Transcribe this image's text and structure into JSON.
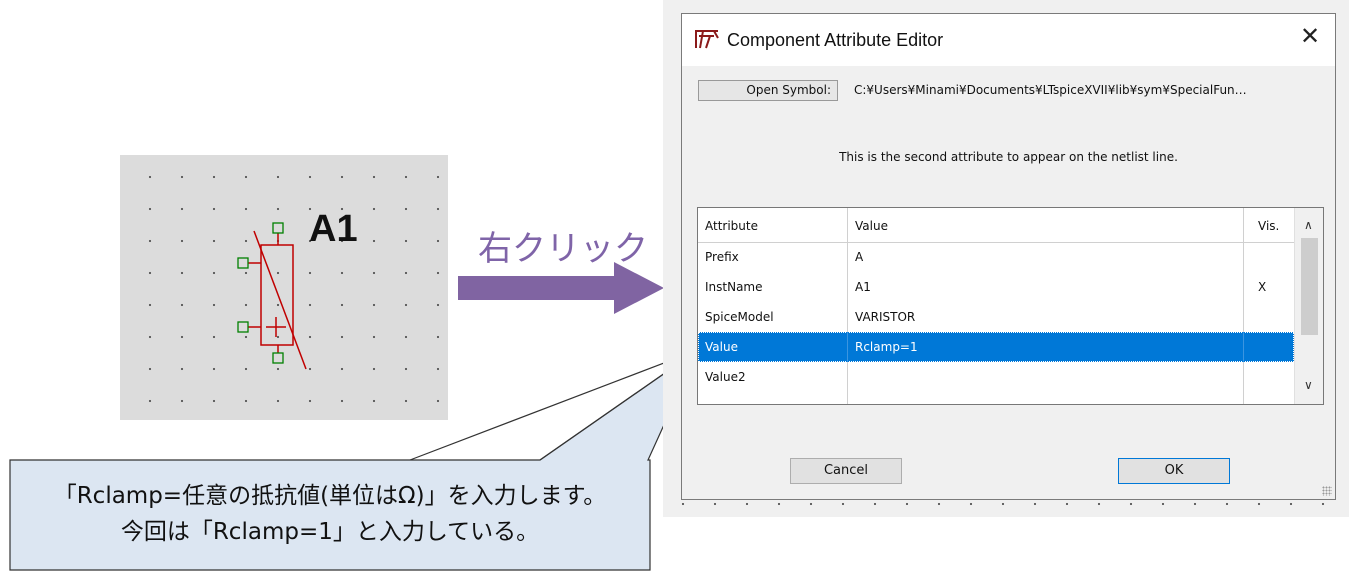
{
  "schematic": {
    "component_label": "A1"
  },
  "arrow": {
    "label": "右クリック",
    "color": "#8064a2"
  },
  "callout": {
    "line1": "「Rclamp=任意の抵抗値(単位はΩ)」を入力します。",
    "line2": "今回は「Rclamp=1」と入力している。"
  },
  "dialog": {
    "title": "Component Attribute Editor",
    "open_symbol_label": "Open Symbol:",
    "symbol_path": "C:¥Users¥Minami¥Documents¥LTspiceXVII¥lib¥sym¥SpecialFun…",
    "description": "This is the second attribute to appear on the netlist line.",
    "table": {
      "headers": [
        "Attribute",
        "Value",
        "Vis."
      ],
      "rows": [
        {
          "attribute": "Prefix",
          "value": "A",
          "vis": ""
        },
        {
          "attribute": "InstName",
          "value": "A1",
          "vis": "X"
        },
        {
          "attribute": "SpiceModel",
          "value": "VARISTOR",
          "vis": ""
        },
        {
          "attribute": "Value",
          "value": "Rclamp=1",
          "vis": ""
        },
        {
          "attribute": "Value2",
          "value": "",
          "vis": ""
        }
      ],
      "selected_index": 3
    },
    "cancel_label": "Cancel",
    "ok_label": "OK"
  },
  "colors": {
    "selection": "#0078d7",
    "symbol_red": "#c00000",
    "pin_green": "#008000",
    "callout_fill": "#dce6f2"
  }
}
